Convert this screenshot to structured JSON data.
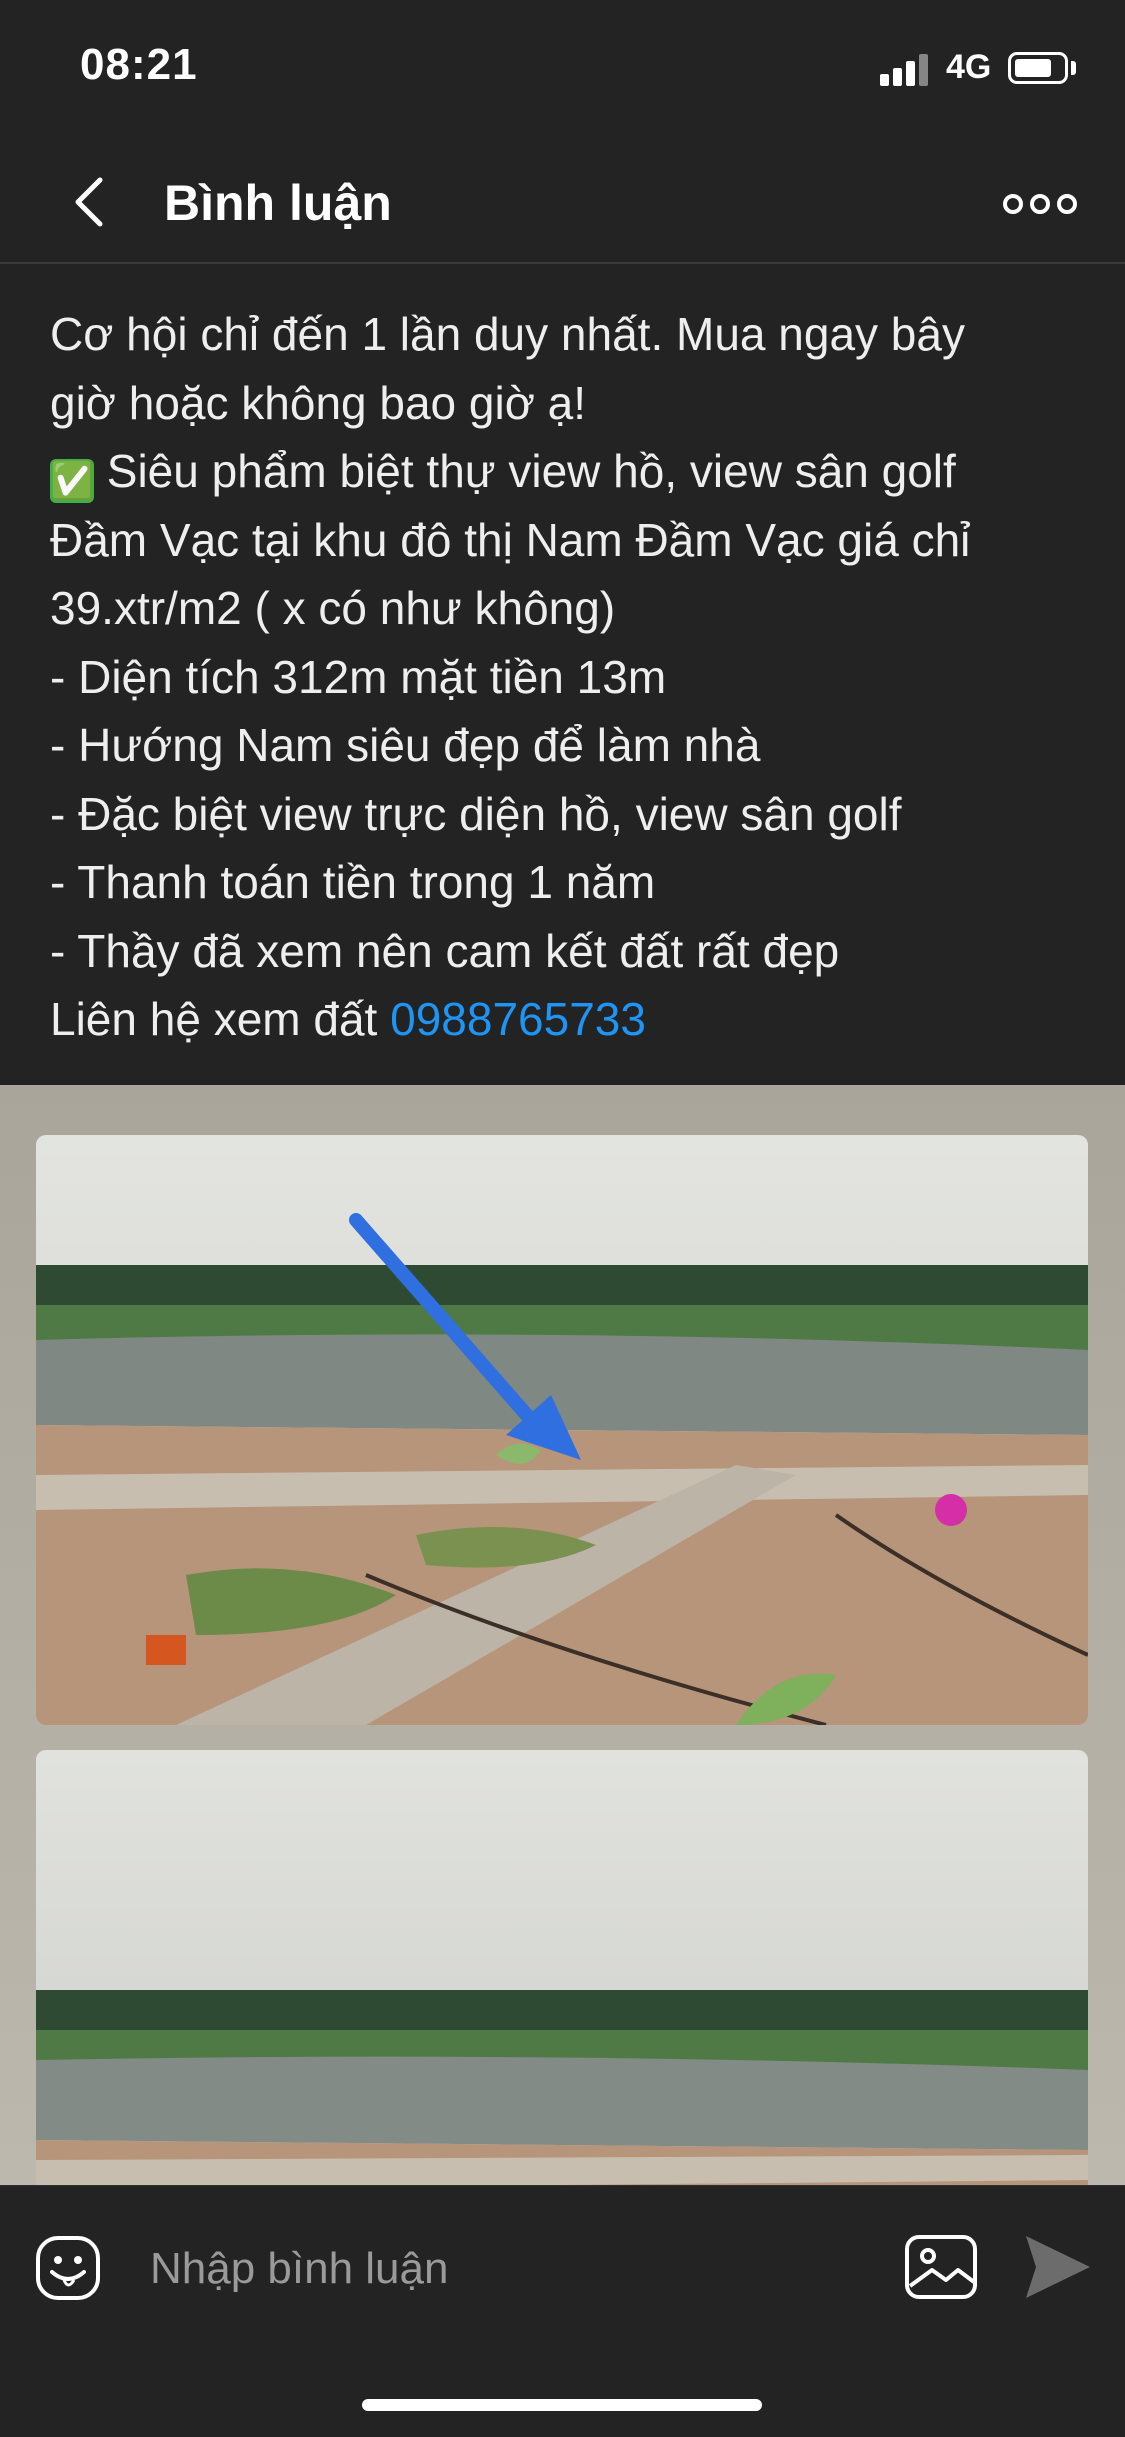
{
  "status": {
    "time": "08:21",
    "network": "4G"
  },
  "header": {
    "title": "Bình luận"
  },
  "post": {
    "lines": [
      "Cơ hội chỉ đến 1 lần duy nhất. Mua ngay bây",
      "giờ hoặc không bao giờ ạ!",
      "Siêu phẩm biệt thự view hồ, view sân golf",
      "Đầm Vạc tại khu đô thị Nam Đầm Vạc giá chỉ",
      "39.xtr/m2 ( x có như không)",
      "- Diện tích 312m mặt tiền 13m",
      "- Hướng Nam siêu đẹp để làm nhà",
      "- Đặc biệt view trực diện hồ, view sân golf",
      "- Thanh toán tiền trong 1 năm",
      "- Thầy đã xem nên cam kết đất rất đẹp"
    ],
    "contact_label": "Liên hệ xem đất",
    "phone": "0988765733",
    "check_emoji": "✅"
  },
  "comment_bar": {
    "placeholder": "Nhập bình luận"
  },
  "colors": {
    "background": "#232323",
    "link": "#1e95f5",
    "check": "#3eb049"
  },
  "icons": [
    "back-icon",
    "more-icon",
    "emoji-icon",
    "image-icon",
    "send-icon"
  ]
}
